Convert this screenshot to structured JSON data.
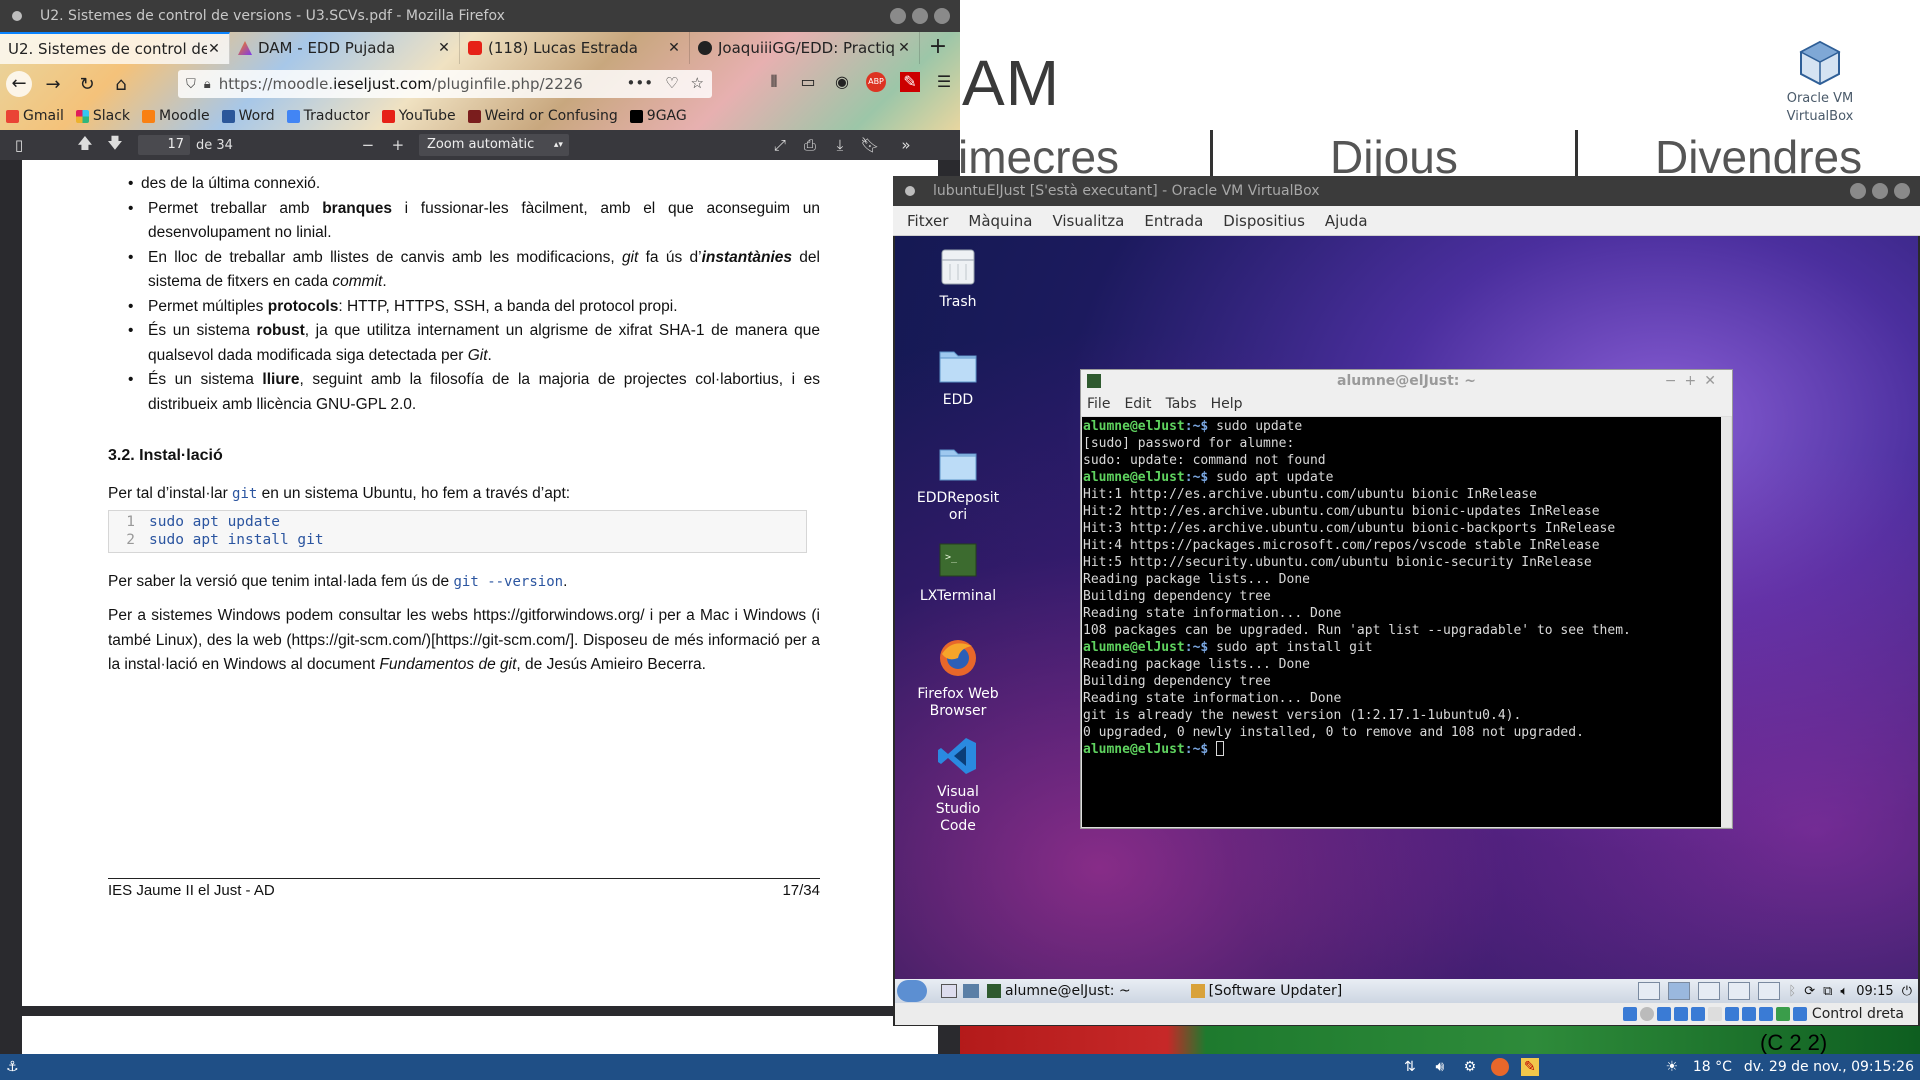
{
  "firefox": {
    "window_title": "U2. Sistemes de control de versions - U3.SCVs.pdf - Mozilla Firefox",
    "tabs": [
      {
        "label": "U2. Sistemes de control de",
        "active": true
      },
      {
        "label": "DAM - EDD Pujada",
        "active": false
      },
      {
        "label": "(118) Lucas Estrada",
        "active": false
      },
      {
        "label": "JoaquiiiGG/EDD: Practiq",
        "active": false
      }
    ],
    "url_prefix": "https://moodle.",
    "url_domain": "ieseljust.com",
    "url_path": "/pluginfile.php/2226",
    "bookmarks": [
      "Gmail",
      "Slack",
      "Moodle",
      "Word",
      "Traductor",
      "YouTube",
      "Weird or Confusing",
      "9GAG"
    ],
    "pdf_toolbar": {
      "page_number": "17",
      "page_of": "de 34",
      "zoom": "Zoom automàtic"
    }
  },
  "pdf": {
    "bullets": [
      {
        "html": "des de la última connexió."
      },
      {
        "html": "Permet treballar amb <b>branques</b> i fussionar-les fàcilment, amb el que aconseguim un desenvolupament no linial."
      },
      {
        "html": "En lloc de treballar amb llistes de canvis amb les modificacions, <i>git</i> fa ús d’<b><i>instantànies</i></b> del sistema de fitxers en cada <i>commit</i>."
      },
      {
        "html": "Permet múltiples <b>protocols</b>: HTTP, HTTPS, SSH, a banda del protocol propi."
      },
      {
        "html": "És un sistema <b>robust</b>, ja que utilitza internament un algrisme de xifrat SHA-1 de manera que qualsevol dada modificada siga detectada per <i>Git</i>."
      },
      {
        "html": "És un sistema <b>lliure</b>, seguint amb la filosofía de la majoria de projectes col·labortius, i es distribueix amb llicència GNU-GPL 2.0."
      }
    ],
    "section_title": "3.2. Instal·lació",
    "install_intro_pre": "Per tal d’instal·lar ",
    "install_intro_code": "git",
    "install_intro_post": " en un sistema Ubuntu, ho fem a través d’apt:",
    "code_lines": [
      {
        "n": "1",
        "text": "sudo apt update"
      },
      {
        "n": "2",
        "text": "sudo apt install git"
      }
    ],
    "version_pre": "Per saber la versió que tenim intal·lada fem ús de ",
    "version_code": "git --version",
    "version_post": ".",
    "windows_para_html": "Per a sistemes Windows podem consultar les webs https://gitforwindows.org/ i per a Mac i Windows (i també Linux), des la web (https://git-scm.com/)[https://git-scm.com/]. Disposeu de més informació per a la instal·lació en Windows al document <i>Fundamentos de git</i>, de Jesús Amieiro Becerra.",
    "footer_left": "IES Jaume II el Just - AD",
    "footer_right": "17/34"
  },
  "desktop": {
    "logo_text": "AM",
    "days": [
      "imecres",
      "Dijous",
      "Divendres"
    ],
    "bottom_text": "(C 2 2)",
    "vbox_icon_label": "Oracle VM VirtualBox"
  },
  "vbox": {
    "window_title": "lubuntuElJust [S'està executant] - Oracle VM VirtualBox",
    "menu": [
      "Fitxer",
      "Màquina",
      "Visualitza",
      "Entrada",
      "Dispositius",
      "Ajuda"
    ],
    "status_text": "Control dreta"
  },
  "guest": {
    "icons": [
      "Trash",
      "EDD",
      "EDDRepositori",
      "LXTerminal",
      "Firefox Web Browser",
      "Visual Studio Code"
    ],
    "terminal": {
      "title": "alumne@elJust: ~",
      "menu": [
        "File",
        "Edit",
        "Tabs",
        "Help"
      ],
      "lines": [
        {
          "type": "prompt",
          "user": "alumne@elJust",
          "path": ":~$ ",
          "cmd": "sudo update"
        },
        {
          "type": "out",
          "text": "[sudo] password for alumne:"
        },
        {
          "type": "out",
          "text": "sudo: update: command not found"
        },
        {
          "type": "prompt",
          "user": "alumne@elJust",
          "path": ":~$ ",
          "cmd": "sudo apt update"
        },
        {
          "type": "out",
          "text": "Hit:1 http://es.archive.ubuntu.com/ubuntu bionic InRelease"
        },
        {
          "type": "out",
          "text": "Hit:2 http://es.archive.ubuntu.com/ubuntu bionic-updates InRelease"
        },
        {
          "type": "out",
          "text": "Hit:3 http://es.archive.ubuntu.com/ubuntu bionic-backports InRelease"
        },
        {
          "type": "out",
          "text": "Hit:4 https://packages.microsoft.com/repos/vscode stable InRelease"
        },
        {
          "type": "out",
          "text": "Hit:5 http://security.ubuntu.com/ubuntu bionic-security InRelease"
        },
        {
          "type": "out",
          "text": "Reading package lists... Done"
        },
        {
          "type": "out",
          "text": "Building dependency tree"
        },
        {
          "type": "out",
          "text": "Reading state information... Done"
        },
        {
          "type": "out",
          "text": "108 packages can be upgraded. Run 'apt list --upgradable' to see them."
        },
        {
          "type": "prompt",
          "user": "alumne@elJust",
          "path": ":~$ ",
          "cmd": "sudo apt install git"
        },
        {
          "type": "out",
          "text": "Reading package lists... Done"
        },
        {
          "type": "out",
          "text": "Building dependency tree"
        },
        {
          "type": "out",
          "text": "Reading state information... Done"
        },
        {
          "type": "out",
          "text": "git is already the newest version (1:2.17.1-1ubuntu0.4)."
        },
        {
          "type": "out",
          "text": "0 upgraded, 0 newly installed, 0 to remove and 108 not upgraded."
        },
        {
          "type": "prompt-cursor",
          "user": "alumne@elJust",
          "path": ":~$ ",
          "cmd": ""
        }
      ]
    },
    "panel": {
      "task1": "alumne@elJust: ~",
      "task2": "[Software Updater]",
      "clock": "09:15"
    }
  },
  "host_taskbar": {
    "weather": "18 °C",
    "datetime": "dv. 29 de nov., 09:15:26"
  }
}
